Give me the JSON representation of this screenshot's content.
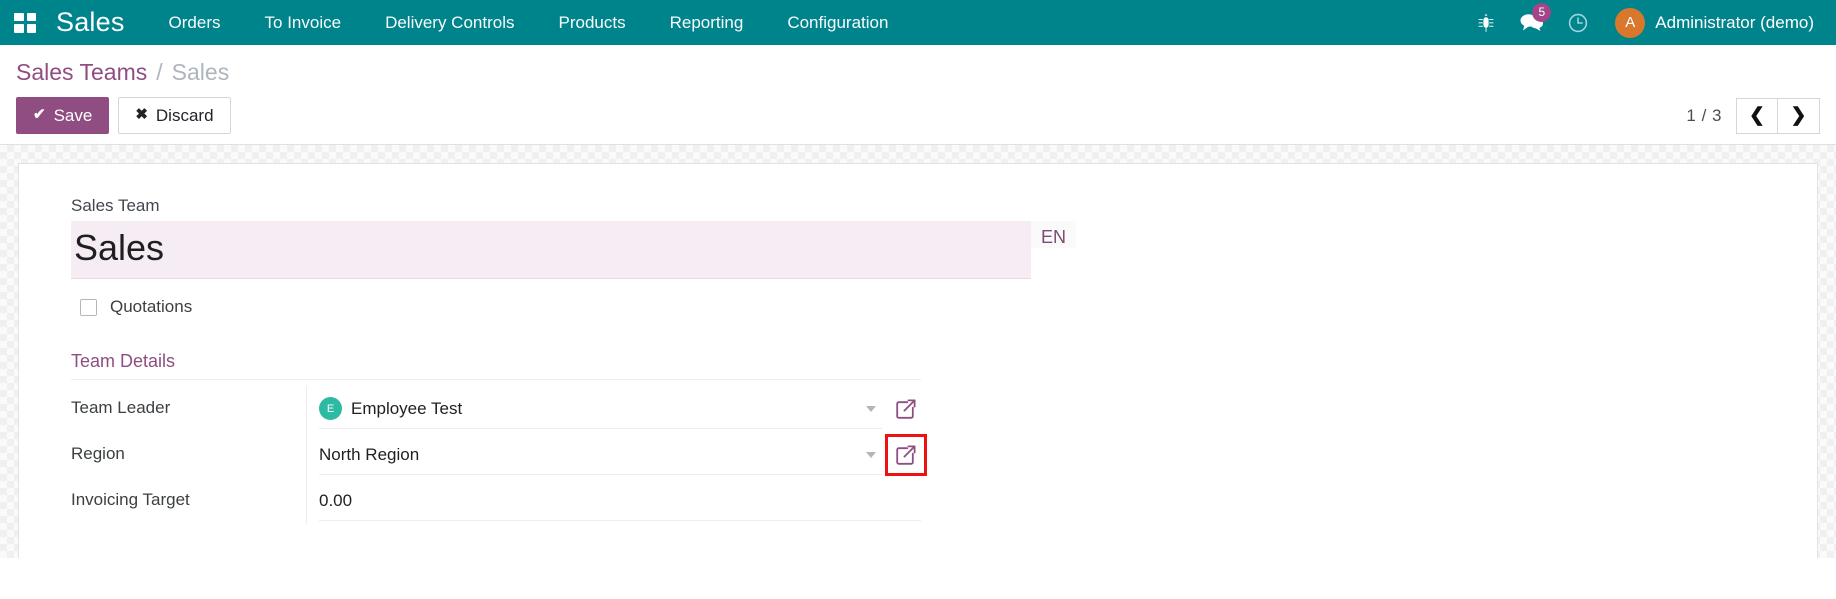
{
  "navbar": {
    "apps_icon": "apps-grid-icon",
    "brand": "Sales",
    "menu": [
      {
        "label": "Orders"
      },
      {
        "label": "To Invoice"
      },
      {
        "label": "Delivery Controls"
      },
      {
        "label": "Products"
      },
      {
        "label": "Reporting"
      },
      {
        "label": "Configuration"
      }
    ],
    "icons": {
      "debug": "bug-icon",
      "messages": "messages-icon",
      "messages_count": "5",
      "activities": "clock-icon"
    },
    "user": {
      "initial": "A",
      "name": "Administrator (demo)"
    }
  },
  "control_panel": {
    "breadcrumb": {
      "root": "Sales Teams",
      "separator": "/",
      "current": "Sales"
    },
    "save_label": "Save",
    "save_icon": "check-icon",
    "discard_label": "Discard",
    "discard_icon": "close-icon",
    "pager": {
      "value": "1 / 3",
      "prev_icon": "chevron-left-icon",
      "next_icon": "chevron-right-icon"
    }
  },
  "form": {
    "title_label": "Sales Team",
    "title_value": "Sales",
    "lang_badge": "EN",
    "quotations_label": "Quotations",
    "quotations_checked": false,
    "group_title": "Team Details",
    "fields": [
      {
        "label": "Team Leader",
        "value": "Employee Test",
        "avatar_initial": "E",
        "has_avatar": true,
        "has_caret": true,
        "has_external_link": true,
        "highlighted": false
      },
      {
        "label": "Region",
        "value": "North Region",
        "has_avatar": false,
        "has_caret": true,
        "has_external_link": true,
        "highlighted": true
      },
      {
        "label": "Invoicing Target",
        "value": "0.00",
        "has_avatar": false,
        "has_caret": false,
        "has_external_link": false,
        "highlighted": false
      }
    ]
  },
  "colors": {
    "navbar_teal": "#00848c",
    "accent_purple": "#8f4d82",
    "avatar_orange": "#d9782d",
    "badge_purple": "#a24689",
    "leader_avatar_teal": "#2dbaa3",
    "highlight_red": "#ee1111",
    "title_field_bg": "#f5ecf4"
  }
}
